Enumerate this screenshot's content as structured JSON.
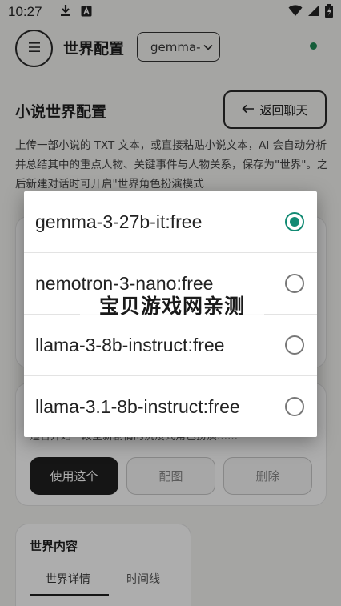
{
  "status_bar": {
    "time": "10:27",
    "left_icons": [
      "download-icon",
      "a-box-icon"
    ],
    "right_icons": [
      "wifi-icon",
      "signal-icon",
      "battery-icon"
    ]
  },
  "header": {
    "title": "世界配置",
    "model_select_value": "gemma-",
    "online_color": "#1e8a55"
  },
  "page": {
    "section_title": "小说世界配置",
    "back_label": "返回聊天",
    "description": "上传一部小说的 TXT 文本，或直接粘贴小说文本，AI 会自动分析并总结其中的重点人物、关键事件与人物关系，保存为\"世界\"。之后新建对话时可开启\"世界角色扮演模式"
  },
  "world_card": {
    "partial_text": "适合开始一段全新剧情的沉浸式角色扮演……",
    "use_label": "使用这个",
    "map_label": "配图",
    "delete_label": "删除"
  },
  "content_card": {
    "title": "世界内容",
    "tabs": [
      {
        "label": "世界详情"
      },
      {
        "label": "时间线"
      }
    ]
  },
  "dialog": {
    "accent_color": "#118a73",
    "options": [
      {
        "label": "gemma-3-27b-it:free",
        "selected": true
      },
      {
        "label": "nemotron-3-nano:free",
        "selected": false
      },
      {
        "label": "llama-3-8b-instruct:free",
        "selected": false
      },
      {
        "label": "llama-3.1-8b-instruct:free",
        "selected": false
      }
    ]
  },
  "watermark": "宝贝游戏网亲测"
}
